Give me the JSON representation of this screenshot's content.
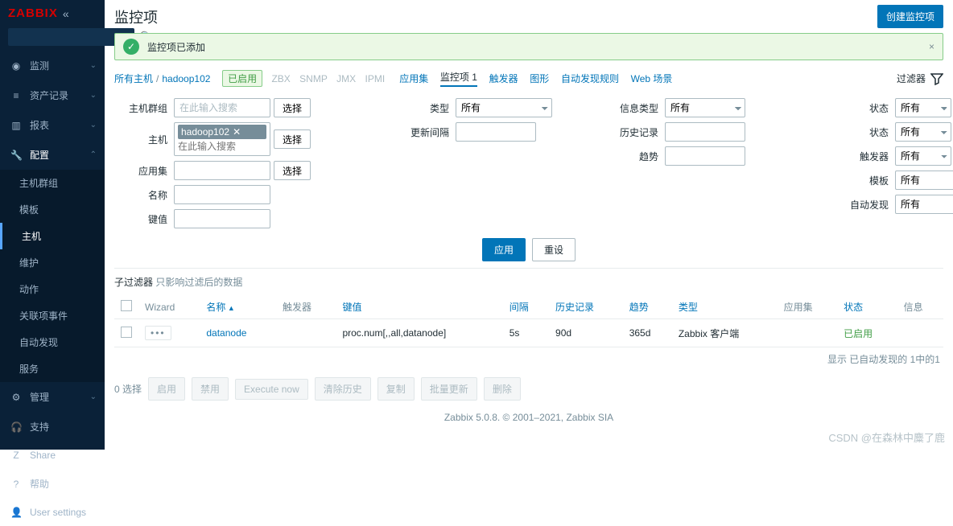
{
  "logo": {
    "brand_red": "ZABBIX"
  },
  "sidebar": {
    "search_placeholder": "",
    "items": [
      {
        "icon": "👁",
        "label": "监测"
      },
      {
        "icon": "≡",
        "label": "资产记录"
      },
      {
        "icon": "▥",
        "label": "报表"
      },
      {
        "icon": "🔧",
        "label": "配置",
        "expanded": true,
        "subs": [
          "主机群组",
          "模板",
          "主机",
          "维护",
          "动作",
          "关联项事件",
          "自动发现",
          "服务"
        ],
        "active_sub": "主机"
      },
      {
        "icon": "⚙",
        "label": "管理"
      },
      {
        "icon": "🎧",
        "label": "支持"
      },
      {
        "icon": "Z",
        "label": "Share"
      },
      {
        "icon": "?",
        "label": "帮助"
      },
      {
        "icon": "👤",
        "label": "User settings"
      }
    ]
  },
  "page": {
    "title": "监控项",
    "create_btn": "创建监控项"
  },
  "message": {
    "text": "监控项已添加"
  },
  "breadcrumb": {
    "all_hosts": "所有主机",
    "host": "hadoop102",
    "enabled": "已启用",
    "dim": [
      "ZBX",
      "SNMP",
      "JMX",
      "IPMI"
    ],
    "tabs": [
      "应用集",
      "监控项 1",
      "触发器",
      "图形",
      "自动发现规则",
      "Web 场景"
    ],
    "active_tab": "监控项 1",
    "filter_label": "过滤器"
  },
  "filter": {
    "labels": {
      "hostgroup": "主机群组",
      "host": "主机",
      "appset": "应用集",
      "name": "名称",
      "key": "键值",
      "type": "类型",
      "interval": "更新间隔",
      "infotype": "信息类型",
      "history": "历史记录",
      "trend": "趋势",
      "state": "状态",
      "status": "状态",
      "trigger": "触发器",
      "template": "模板",
      "discovery": "自动发现"
    },
    "placeholders": {
      "search": "在此输入搜索"
    },
    "options": {
      "all": "所有"
    },
    "host_tag": "hadoop102",
    "select_btn": "选择",
    "apply": "应用",
    "reset": "重设"
  },
  "subfilter": {
    "title": "子过滤器",
    "hint": " 只影响过滤后的数据"
  },
  "table": {
    "headers": {
      "wizard": "Wizard",
      "name": "名称",
      "trigger": "触发器",
      "key": "键值",
      "interval": "间隔",
      "history": "历史记录",
      "trend": "趋势",
      "type": "类型",
      "appset": "应用集",
      "status": "状态",
      "info": "信息"
    },
    "rows": [
      {
        "wizard": "•••",
        "name": "datanode",
        "trigger": "",
        "key": "proc.num[,,all,datanode]",
        "interval": "5s",
        "history": "90d",
        "trend": "365d",
        "type": "Zabbix 客户端",
        "appset": "",
        "status": "已启用",
        "info": ""
      }
    ],
    "footer": "显示 已自动发现的 1中的1"
  },
  "bulk": {
    "count": "0 选择",
    "buttons": [
      "启用",
      "禁用",
      "Execute now",
      "清除历史",
      "复制",
      "批量更新",
      "删除"
    ]
  },
  "footer": {
    "text": "Zabbix 5.0.8. © 2001–2021, Zabbix SIA"
  },
  "watermark": "CSDN @在森林中麋了鹿"
}
